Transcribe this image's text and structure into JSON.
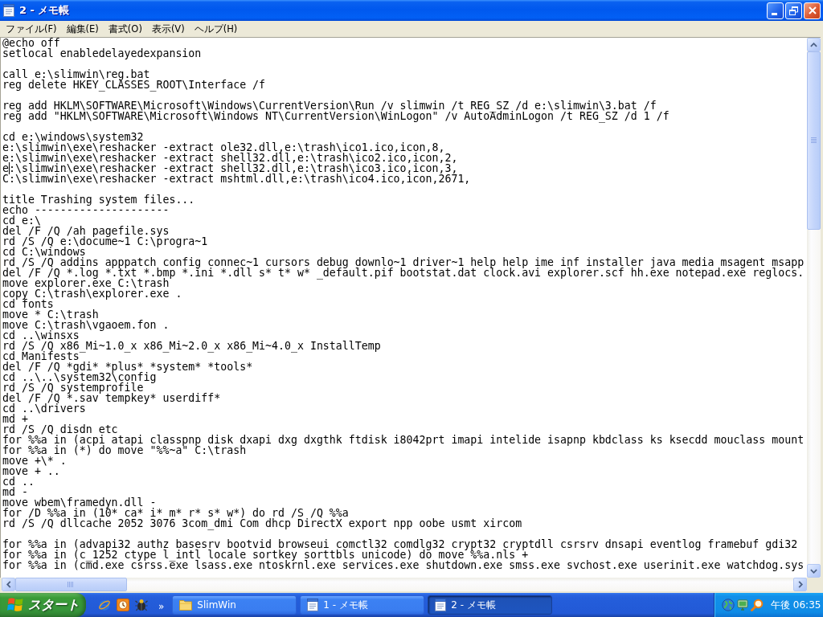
{
  "window": {
    "title": "2 - メモ帳",
    "maximized": true
  },
  "menu": [
    "ファイル(F)",
    "編集(E)",
    "書式(O)",
    "表示(V)",
    "ヘルプ(H)"
  ],
  "editor": {
    "blocks": [
      [
        "@echo off",
        "setlocal enabledelayedexpansion"
      ],
      [
        "call e:\\slimwin\\reg.bat",
        "reg delete HKEY_CLASSES_ROOT\\Interface /f"
      ],
      [
        "reg add HKLM\\SOFTWARE\\Microsoft\\Windows\\CurrentVersion\\Run /v slimwin /t REG_SZ /d e:\\slimwin\\3.bat /f",
        "reg add \"HKLM\\SOFTWARE\\Microsoft\\Windows NT\\CurrentVersion\\WinLogon\" /v AutoAdminLogon /t REG_SZ /d 1 /f"
      ],
      [
        "cd e:\\windows\\system32",
        "e:\\slimwin\\exe\\reshacker -extract ole32.dll,e:\\trash\\ico1.ico,icon,8,",
        "e:\\slimwin\\exe\\reshacker -extract shell32.dll,e:\\trash\\ico2.ico,icon,2,",
        {
          "before_caret": "e",
          "after_caret": ":\\slimwin\\exe\\reshacker -extract shell32.dll,e:\\trash\\ico3.ico,icon,3,"
        },
        "C:\\slimwin\\exe\\reshacker -extract mshtml.dll,e:\\trash\\ico4.ico,icon,2671,"
      ],
      [
        "title Trashing system files...",
        "echo ---------------------",
        "cd e:\\",
        "del /F /Q /ah pagefile.sys",
        "rd /S /Q e:\\docume~1 C:\\progra~1",
        "cd C:\\windows",
        "rd /S /Q addins apppatch config connec~1 cursors debug downlo~1 driver~1 help help ime inf installer java media msagent msapp",
        "del /F /Q *.log *.txt *.bmp *.ini *.dll s* t* w* _default.pif bootstat.dat clock.avi explorer.scf hh.exe notepad.exe reglocs.",
        "move explorer.exe C:\\trash",
        "copy C:\\trash\\explorer.exe .",
        "cd fonts",
        "move * C:\\trash",
        "move C:\\trash\\vgaoem.fon .",
        "cd ..\\winsxs",
        "rd /S /Q x86_Mi~1.0_x x86_Mi~2.0_x x86_Mi~4.0_x InstallTemp",
        "cd Manifests",
        "del /F /Q *gdi* *plus* *system* *tools*",
        "cd ..\\..\\system32\\config",
        "rd /S /Q systemprofile",
        "del /F /Q *.sav tempkey* userdiff*",
        "cd ..\\drivers",
        "md +",
        "rd /S /Q disdn etc",
        "for %%a in (acpi atapi classpnp disk dxapi dxg dxgthk ftdisk i8042prt imapi intelide isapnp kbdclass ks ksecdd mouclass mount",
        "for %%a in (*) do move \"%%~a\" C:\\trash",
        "move +\\* .",
        "move + ..",
        "cd ..",
        "md -",
        "move wbem\\framedyn.dll -",
        "for /D %%a in (10* ca* i* m* r* s* w*) do rd /S /Q %%a",
        "rd /S /Q dllcache 2052 3076 3com_dmi Com dhcp DirectX export npp oobe usmt xircom"
      ],
      [
        "for %%a in (advapi32 authz basesrv bootvid browseui comctl32 comdlg32 crypt32 cryptdll csrsrv dnsapi eventlog framebuf gdi32",
        "for %%a in (c_1252 ctype l_intl locale sortkey sorttbls unicode) do move %%a.nls +",
        "for %%a in (cmd.exe csrss.exe lsass.exe ntoskrnl.exe services.exe shutdown.exe smss.exe svchost.exe userinit.exe watchdog.sys"
      ]
    ]
  },
  "taskbar": {
    "start": "スタート",
    "more": "»",
    "tasks": [
      {
        "label": "SlimWin",
        "kind": "folder",
        "selected": false
      },
      {
        "label": "1 - メモ帳",
        "kind": "notepad",
        "selected": false
      },
      {
        "label": "2 - メモ帳",
        "kind": "notepad",
        "selected": true
      }
    ],
    "clock": "午後 06:35"
  }
}
